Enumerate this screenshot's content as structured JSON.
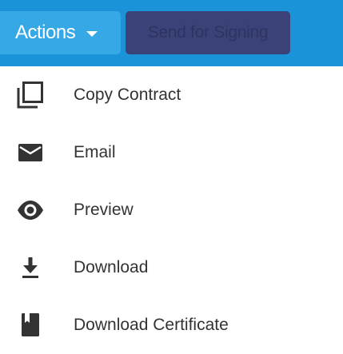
{
  "toolbar": {
    "actions_label": "Actions",
    "send_label": "Send for Signing"
  },
  "colors": {
    "toolbar_bg": "#1a93d8",
    "actions_bg": "#37a8e6",
    "send_bg": "#3b4277",
    "icon": "#333333",
    "text": "#333333"
  },
  "menu": {
    "items": [
      {
        "label": "Copy Contract",
        "icon": "copy-icon"
      },
      {
        "label": "Email",
        "icon": "email-icon"
      },
      {
        "label": "Preview",
        "icon": "eye-icon"
      },
      {
        "label": "Download",
        "icon": "download-icon"
      },
      {
        "label": "Download Certificate",
        "icon": "certificate-icon"
      }
    ]
  }
}
